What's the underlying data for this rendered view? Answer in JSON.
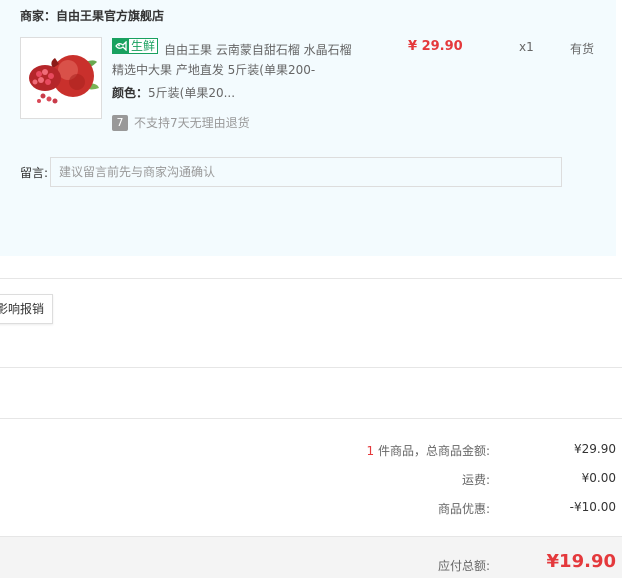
{
  "store": {
    "label": "商家：",
    "name": "自由王果官方旗舰店"
  },
  "product": {
    "badge": "生鲜",
    "title": "自由王果 云南蒙自甜石榴 水晶石榴 精选中大果 产地直发 5斤装(单果200-",
    "color_label": "颜色：",
    "color_value": "5斤装(单果20...",
    "return_policy": "不支持7天无理由退货",
    "return_icon_text": "7",
    "price": "¥ 29.90",
    "quantity": "x1",
    "stock": "有货"
  },
  "remark": {
    "label": "留言:",
    "placeholder": "建议留言前先与商家沟通确认"
  },
  "invoice": {
    "button_label": "影响报销"
  },
  "summary": {
    "count": "1",
    "count_suffix": " 件商品，总商品金额:",
    "goods_total": "¥29.90",
    "shipping_label": "运费:",
    "shipping_value": "¥0.00",
    "discount_label": "商品优惠:",
    "discount_value": "-¥10.00"
  },
  "total": {
    "label": "应付总额:",
    "value": "¥19.90"
  },
  "colors": {
    "accent": "#e4393c",
    "fresh_badge": "#19a15f",
    "panel_bg": "#f3fbfe"
  },
  "icons": {
    "badge_icon": "fish-icon",
    "return_icon": "no-return-icon"
  }
}
